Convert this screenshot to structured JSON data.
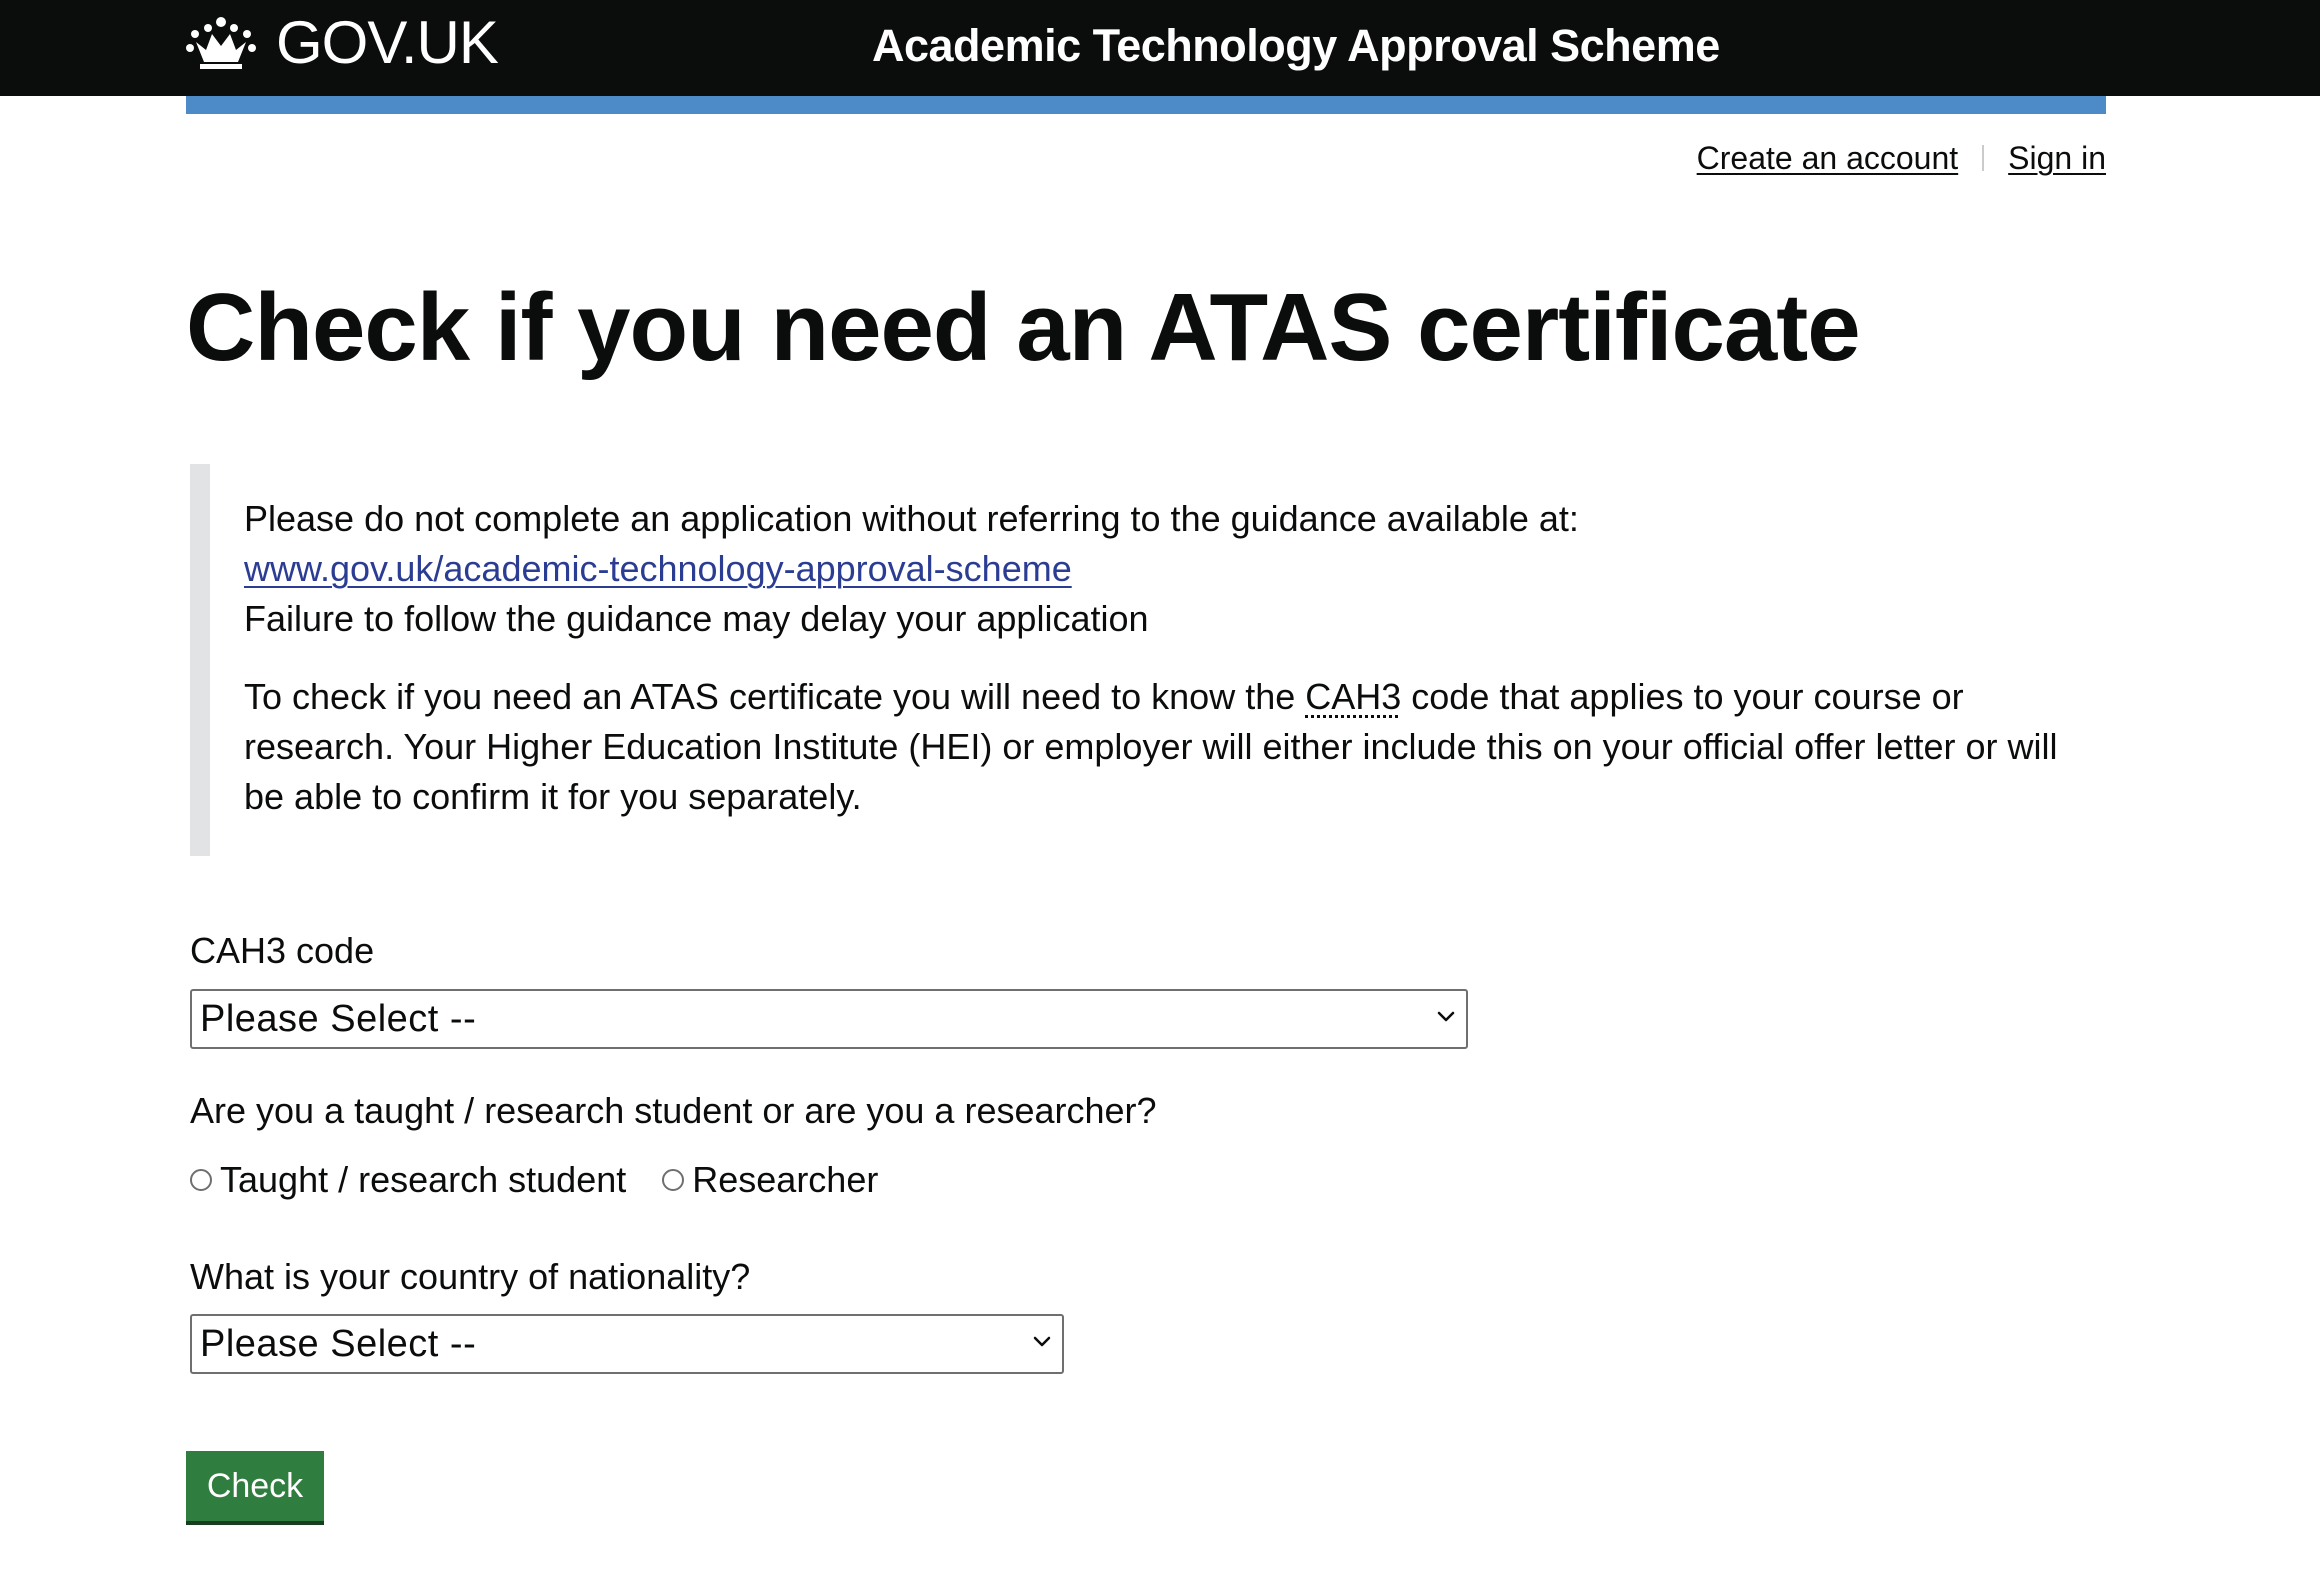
{
  "header": {
    "logo_text": "GOV.UK",
    "service_name": "Academic Technology Approval Scheme"
  },
  "account_nav": {
    "create_account": "Create an account",
    "sign_in": "Sign in"
  },
  "page_title": "Check if you need an ATAS certificate",
  "inset": {
    "line1": "Please do not complete an application without referring to the guidance available at:",
    "link": "www.gov.uk/academic-technology-approval-scheme",
    "line3": "Failure to follow the guidance may delay your application",
    "para2_before": "To check if you need an ATAS certificate you will need to know the ",
    "para2_abbr": "CAH3",
    "para2_after": " code that applies to your course or research. Your Higher Education Institute (HEI) or employer will either include this on your official offer letter or will be able to confirm it for you separately."
  },
  "form": {
    "cah3_label": "CAH3 code",
    "cah3_value": "Please Select --",
    "status_question": "Are you a taught / research student or are you a researcher?",
    "radio_student": "Taught / research student",
    "radio_researcher": "Researcher",
    "nationality_label": "What is your country of nationality?",
    "nationality_value": "Please Select --",
    "check_button": "Check"
  },
  "colors": {
    "header_bg": "#0b0c0c",
    "blue_bar": "#4c8ac8",
    "link": "#2b3c93",
    "button": "#2f7d3f",
    "inset_border": "#e2e3e5"
  },
  "icons": {
    "logo": "crown-icon",
    "select": "chevron-down-icon"
  }
}
